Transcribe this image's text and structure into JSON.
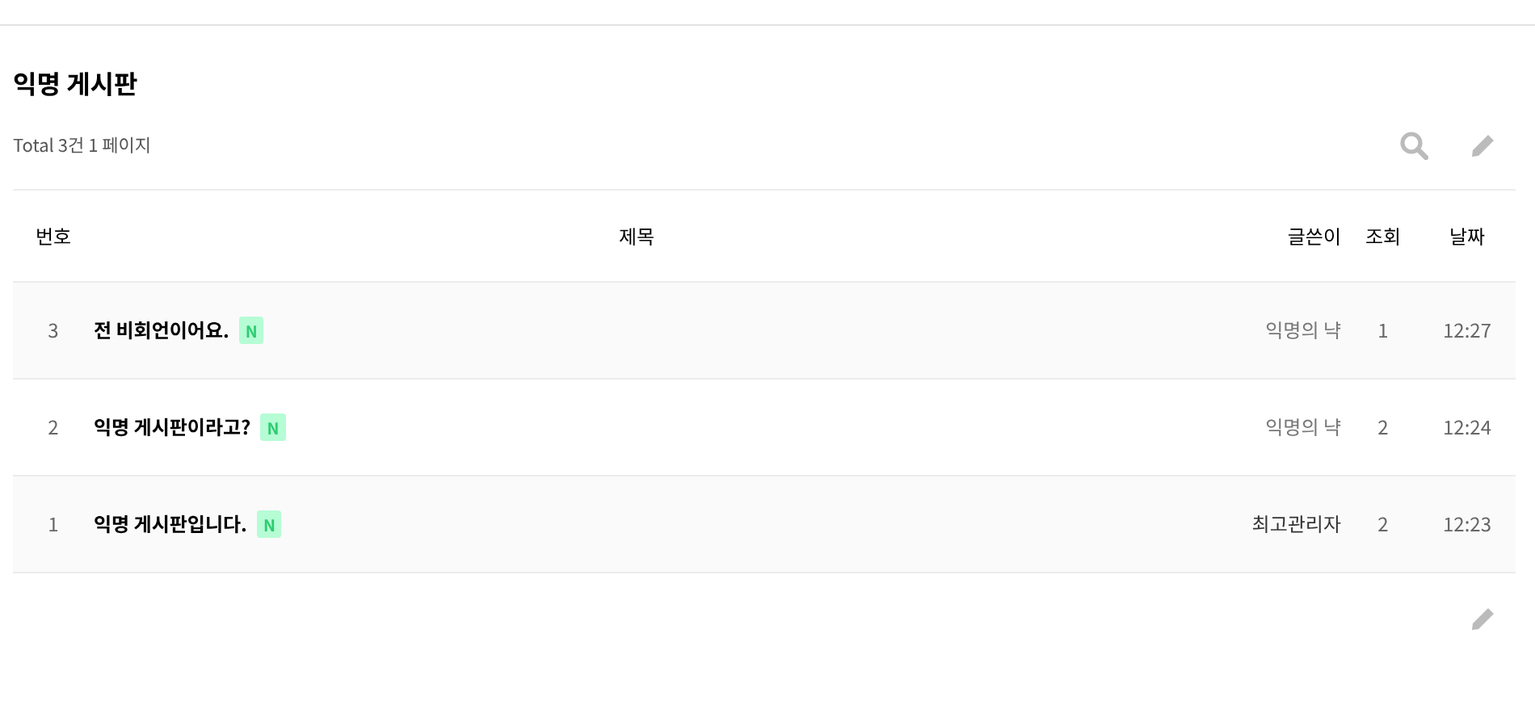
{
  "board": {
    "title": "익명 게시판",
    "summary": "Total 3건 1 페이지"
  },
  "table": {
    "columns": [
      "번호",
      "제목",
      "글쓴이",
      "조회",
      "날짜"
    ],
    "rows": [
      {
        "number": "3",
        "title": "전 비회언이어요.",
        "badge": "N",
        "author": "익명의 냑",
        "member": false,
        "views": "1",
        "date": "12:27"
      },
      {
        "number": "2",
        "title": "익명 게시판이라고?",
        "badge": "N",
        "author": "익명의 냑",
        "member": false,
        "views": "2",
        "date": "12:24"
      },
      {
        "number": "1",
        "title": "익명 게시판입니다.",
        "badge": "N",
        "author": "최고관리자",
        "member": true,
        "views": "2",
        "date": "12:23"
      }
    ]
  }
}
